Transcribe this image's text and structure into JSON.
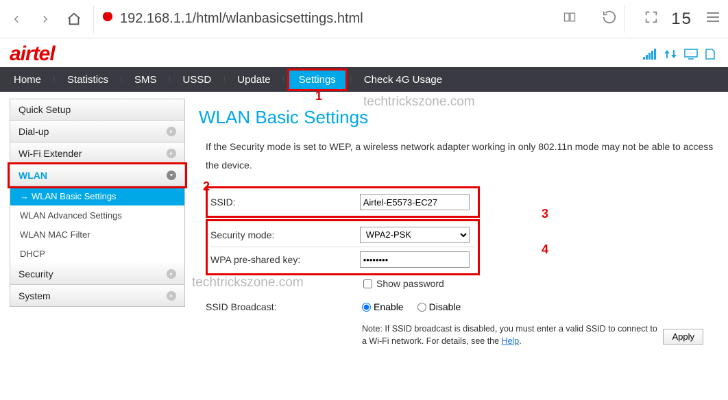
{
  "browser": {
    "url": "192.168.1.1/html/wlanbasicsettings.html",
    "tab_count": "15"
  },
  "brand": "airtel",
  "nav": {
    "home": "Home",
    "statistics": "Statistics",
    "sms": "SMS",
    "ussd": "USSD",
    "update": "Update",
    "settings": "Settings",
    "check4g": "Check 4G Usage"
  },
  "sidebar": {
    "quick_setup": "Quick Setup",
    "dial_up": "Dial-up",
    "wifi_extender": "Wi-Fi Extender",
    "wlan": "WLAN",
    "wlan_sub": {
      "basic": "WLAN Basic Settings",
      "advanced": "WLAN Advanced Settings",
      "mac": "WLAN MAC Filter",
      "dhcp": "DHCP"
    },
    "security": "Security",
    "system": "System"
  },
  "page": {
    "title": "WLAN Basic Settings",
    "note": "If the Security mode is set to WEP, a wireless network adapter working in only 802.11n mode may not be able to access the device.",
    "ssid_label": "SSID:",
    "ssid_value": "Airtel-E5573-EC27",
    "sec_label": "Security mode:",
    "sec_value": "WPA2-PSK",
    "wpa_label": "WPA pre-shared key:",
    "wpa_value": "••••••••",
    "show_pw": "Show password",
    "bcast_label": "SSID Broadcast:",
    "enable": "Enable",
    "disable": "Disable",
    "fine_note_1": "Note: If SSID broadcast is disabled, you must enter a valid SSID to connect to a Wi-Fi network. For details, see the ",
    "help": "Help",
    "apply": "Apply"
  },
  "watermark": "techtrickszone.com",
  "annotations": {
    "a1": "1",
    "a2": "2",
    "a3": "3",
    "a4": "4"
  }
}
